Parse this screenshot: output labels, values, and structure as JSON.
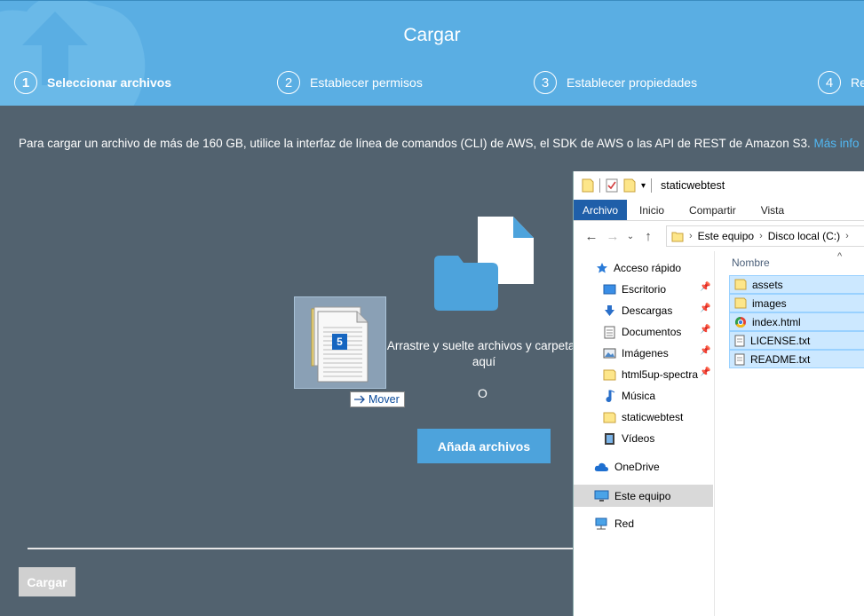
{
  "modal": {
    "title": "Cargar",
    "steps": [
      {
        "num": "1",
        "label": "Seleccionar archivos"
      },
      {
        "num": "2",
        "label": "Establecer permisos"
      },
      {
        "num": "3",
        "label": "Establecer propiedades"
      },
      {
        "num": "4",
        "label": "Re"
      }
    ],
    "notice": "Para cargar un archivo de más de 160 GB, utilice la interfaz de línea de comandos (CLI) de AWS, el SDK de AWS o las API de REST de Amazon S3.",
    "notice_link": "Más info",
    "drop_text": "Arrastre y suelte archivos y carpetas aquí",
    "or": "O",
    "add_files_label": "Añada archivos",
    "drag_count": "5",
    "move_tooltip": "Mover",
    "upload_button": "Cargar"
  },
  "explorer": {
    "window_title": "staticwebtest",
    "ribbon_tabs": [
      "Archivo",
      "Inicio",
      "Compartir",
      "Vista"
    ],
    "breadcrumb": [
      "Este equipo",
      "Disco local (C:)"
    ],
    "nav": {
      "quick_access": "Acceso rápido",
      "items": [
        "Escritorio",
        "Descargas",
        "Documentos",
        "Imágenes",
        "html5up-spectra",
        "Música",
        "staticwebtest",
        "Vídeos"
      ],
      "onedrive": "OneDrive",
      "this_pc": "Este equipo",
      "network": "Red"
    },
    "column_header": "Nombre",
    "files": [
      {
        "name": "assets",
        "icon": "folder-icon"
      },
      {
        "name": "images",
        "icon": "folder-icon"
      },
      {
        "name": "index.html",
        "icon": "chrome-icon"
      },
      {
        "name": "LICENSE.txt",
        "icon": "text-file-icon"
      },
      {
        "name": "README.txt",
        "icon": "text-file-icon"
      }
    ]
  }
}
